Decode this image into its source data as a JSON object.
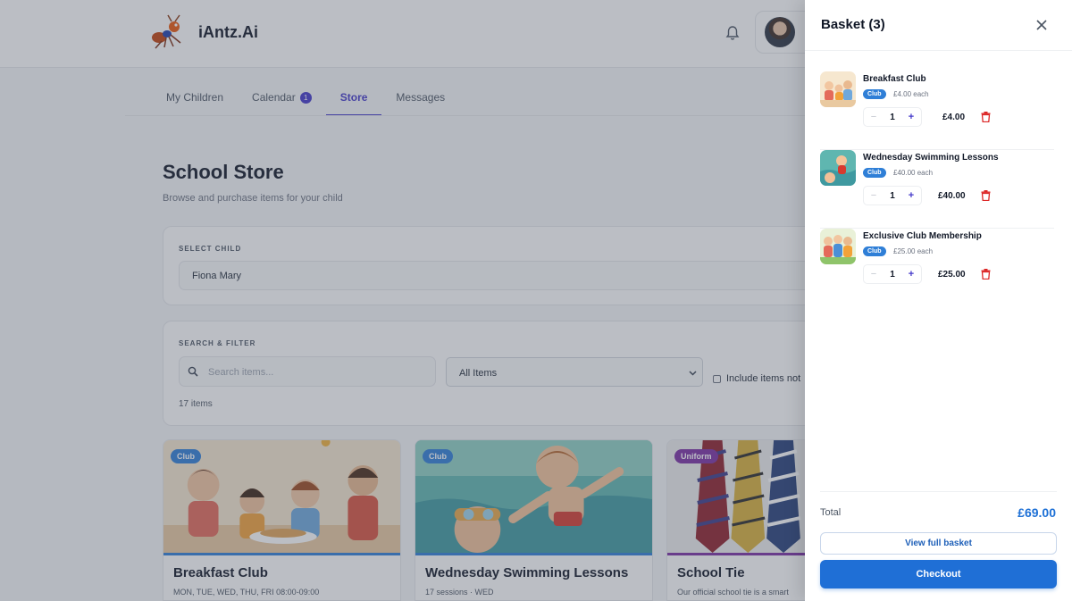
{
  "app": {
    "name": "iAntz.Ai"
  },
  "nav": {
    "tabs": [
      {
        "label": "My Children"
      },
      {
        "label": "Calendar",
        "badge": "1"
      },
      {
        "label": "Store",
        "active": true
      },
      {
        "label": "Messages"
      }
    ]
  },
  "store": {
    "title": "School Store",
    "subtitle": "Browse and purchase items for your child",
    "select_child": {
      "label": "SELECT CHILD",
      "value": "Fiona Mary"
    },
    "filter": {
      "label": "SEARCH & FILTER",
      "search_placeholder": "Search items...",
      "category_value": "All Items",
      "include_label": "Include items not",
      "count": "17 items"
    },
    "products": [
      {
        "badge": "Club",
        "title": "Breakfast Club",
        "meta": "MON, TUE, WED, THU, FRI 08:00-09:00"
      },
      {
        "badge": "Club",
        "title": "Wednesday Swimming Lessons",
        "meta": "17 sessions · WED"
      },
      {
        "badge": "Uniform",
        "title": "School Tie",
        "meta": "Our official school tie is a smart"
      }
    ]
  },
  "basket": {
    "title": "Basket (3)",
    "items": [
      {
        "name": "Breakfast Club",
        "tag": "Club",
        "each": "£4.00 each",
        "qty": "1",
        "total": "£4.00"
      },
      {
        "name": "Wednesday Swimming Lessons",
        "tag": "Club",
        "each": "£40.00 each",
        "qty": "1",
        "total": "£40.00"
      },
      {
        "name": "Exclusive Club Membership",
        "tag": "Club",
        "each": "£25.00 each",
        "qty": "1",
        "total": "£25.00"
      }
    ],
    "total_label": "Total",
    "total_value": "£69.00",
    "view_label": "View full basket",
    "checkout_label": "Checkout"
  },
  "colors": {
    "primary": "#1f6fd6",
    "accent": "#4338ca",
    "club_badge": "#2f7fd7",
    "uniform_badge": "#7b2fa3",
    "delete": "#dc2626"
  },
  "icons": [
    "ant-logo-icon",
    "bell-icon",
    "search-icon",
    "chevron-down-icon",
    "close-icon",
    "minus-icon",
    "plus-icon",
    "trash-icon"
  ]
}
